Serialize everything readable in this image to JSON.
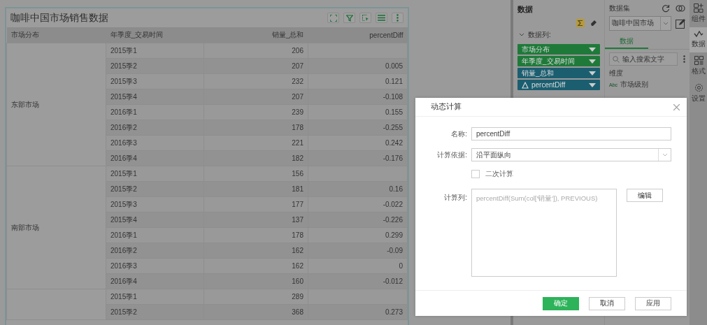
{
  "widget": {
    "title": "咖啡中国市场销售数据",
    "columns": [
      "市场分布",
      "年季度_交易时间",
      "销量_总和",
      "percentDiff"
    ],
    "groups": [
      {
        "market": "东部市场",
        "rows": [
          {
            "period": "2015季1",
            "sales": "206"
          },
          {
            "period": "2015季2",
            "sales": "207",
            "diff": "0.005"
          },
          {
            "period": "2015季3",
            "sales": "232",
            "diff": "0.121"
          },
          {
            "period": "2015季4",
            "sales": "207",
            "diff": "-0.108"
          },
          {
            "period": "2016季1",
            "sales": "239",
            "diff": "0.155"
          },
          {
            "period": "2016季2",
            "sales": "178",
            "diff": "-0.255"
          },
          {
            "period": "2016季3",
            "sales": "221",
            "diff": "0.242"
          },
          {
            "period": "2016季4",
            "sales": "182",
            "diff": "-0.176"
          }
        ]
      },
      {
        "market": "南部市场",
        "rows": [
          {
            "period": "2015季1",
            "sales": "156"
          },
          {
            "period": "2015季2",
            "sales": "181",
            "diff": "0.16"
          },
          {
            "period": "2015季3",
            "sales": "177",
            "diff": "-0.022"
          },
          {
            "period": "2015季4",
            "sales": "137",
            "diff": "-0.226"
          },
          {
            "period": "2016季1",
            "sales": "178",
            "diff": "0.299"
          },
          {
            "period": "2016季2",
            "sales": "162",
            "diff": "-0.09"
          },
          {
            "period": "2016季3",
            "sales": "162",
            "diff": "0"
          },
          {
            "period": "2016季4",
            "sales": "160",
            "diff": "-0.012"
          }
        ]
      },
      {
        "rows": [
          {
            "period": "2015季1",
            "sales": "289"
          },
          {
            "period": "2015季2",
            "sales": "368",
            "diff": "0.273"
          }
        ]
      }
    ]
  },
  "data_panel": {
    "title": "数据",
    "section": {
      "label": "数据列:",
      "expanded": true
    },
    "fields": [
      {
        "label": "市场分布",
        "kind": "dimension"
      },
      {
        "label": "年季度_交易时间",
        "kind": "dimension"
      },
      {
        "label": "销量_总和",
        "kind": "measure"
      },
      {
        "label": "percentDiff",
        "kind": "calculated"
      }
    ]
  },
  "dataset_panel": {
    "title": "数据集",
    "dataset": "咖啡中国市场",
    "tabs": [
      {
        "label": "数据",
        "selected": true
      }
    ],
    "search": {
      "placeholder": "输入搜索文字"
    },
    "section": "维度",
    "items": [
      {
        "type": "Abc",
        "label": "市场级别"
      }
    ]
  },
  "side_bar": [
    {
      "label": "组件",
      "selected": false
    },
    {
      "label": "数据",
      "selected": true
    },
    {
      "label": "格式",
      "selected": false
    },
    {
      "label": "设置",
      "selected": false
    }
  ],
  "dialog": {
    "title": "动态计算",
    "name_label": "名称:",
    "name": "percentDiff",
    "basis_label": "计算依据:",
    "basis": "沿平面纵向",
    "secondary": {
      "label": "二次计算",
      "checked": false
    },
    "formula_label": "计算列:",
    "formula": "percentDiff(Sum(col['销量']), PREVIOUS)",
    "edit_button": "编辑",
    "buttons": [
      {
        "label": "确定",
        "kind": "primary"
      },
      {
        "label": "取消",
        "kind": "default"
      },
      {
        "label": "应用",
        "kind": "default"
      }
    ]
  }
}
